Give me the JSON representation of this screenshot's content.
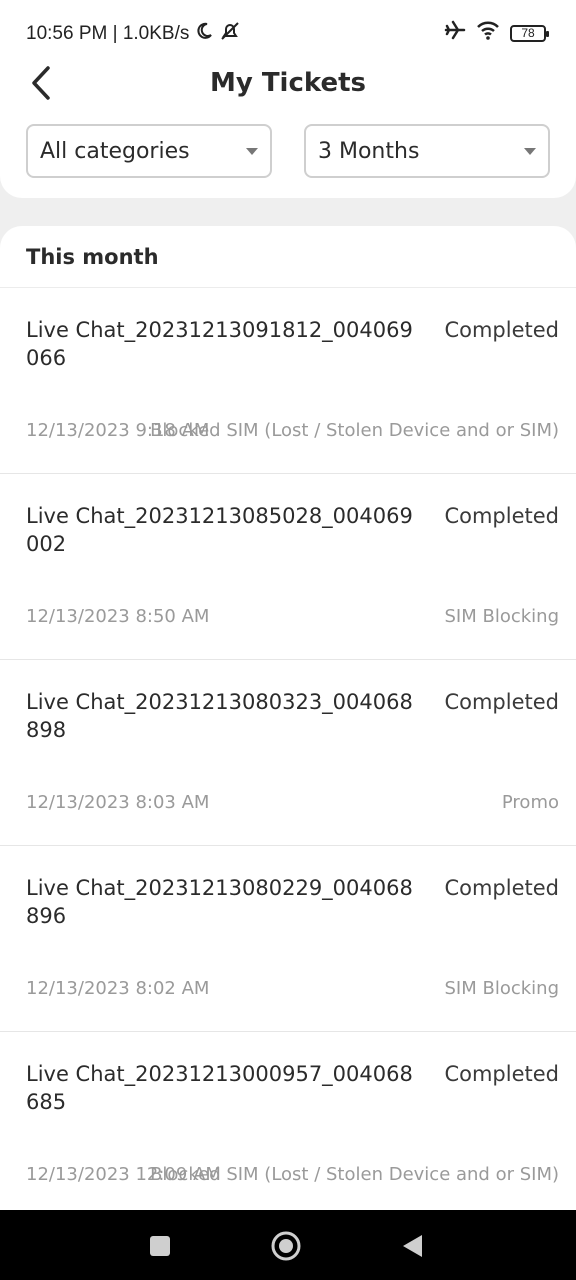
{
  "status_bar": {
    "time_speed": "10:56 PM | 1.0KB/s",
    "battery_level": "78",
    "icons": [
      "moon-icon",
      "bell-off-icon",
      "airplane-icon",
      "wifi-icon",
      "battery-icon"
    ]
  },
  "header": {
    "title": "My Tickets",
    "back_icon": "chevron-left-icon"
  },
  "filters": {
    "category": "All categories",
    "period": "3 Months"
  },
  "section": {
    "title": "This month"
  },
  "tickets": [
    {
      "name": "Live Chat_20231213091812_004069066",
      "status": "Completed",
      "date": "12/13/2023 9:18 AM",
      "category": "Blocked SIM (Lost / Stolen Device and or SIM)"
    },
    {
      "name": "Live Chat_20231213085028_004069002",
      "status": "Completed",
      "date": "12/13/2023 8:50 AM",
      "category": "SIM Blocking"
    },
    {
      "name": "Live Chat_20231213080323_004068898",
      "status": "Completed",
      "date": "12/13/2023 8:03 AM",
      "category": "Promo"
    },
    {
      "name": "Live Chat_20231213080229_004068896",
      "status": "Completed",
      "date": "12/13/2023 8:02 AM",
      "category": "SIM Blocking"
    },
    {
      "name": "Live Chat_20231213000957_004068685",
      "status": "Completed",
      "date": "12/13/2023 12:09 AM",
      "category": "Blocked SIM (Lost / Stolen Device and or SIM)"
    }
  ],
  "nav_bar": {
    "buttons": [
      "square-icon",
      "circle-home-icon",
      "triangle-back-icon"
    ]
  },
  "colors": {
    "page_background": "#efefef",
    "card_background": "#ffffff",
    "primary_text": "#2b2b2b",
    "secondary_text": "#9a9a9a"
  }
}
